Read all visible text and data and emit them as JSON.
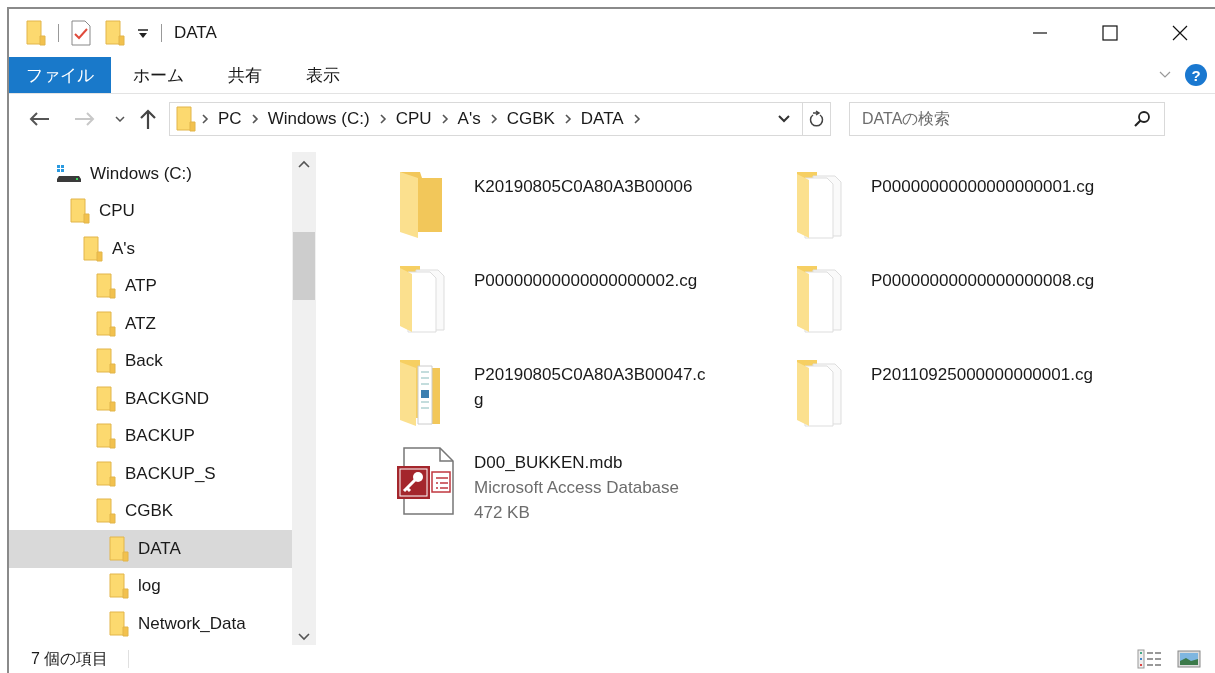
{
  "window": {
    "title": "DATA"
  },
  "ribbon": {
    "tabs": [
      {
        "label": "ファイル",
        "selected": true
      },
      {
        "label": "ホーム",
        "selected": false
      },
      {
        "label": "共有",
        "selected": false
      },
      {
        "label": "表示",
        "selected": false
      }
    ],
    "help_label": "?"
  },
  "navigation": {
    "back_disabled": false,
    "forward_disabled": true
  },
  "address": {
    "path": [
      "PC",
      "Windows (C:)",
      "CPU",
      "A's",
      "CGBK",
      "DATA"
    ]
  },
  "search": {
    "placeholder": "DATAの検索"
  },
  "tree": [
    {
      "label": "Windows (C:)",
      "kind": "drive",
      "selected": false,
      "children": [
        {
          "label": "CPU",
          "kind": "folder",
          "selected": false,
          "children": [
            {
              "label": "A's",
              "kind": "folder",
              "selected": false,
              "children": [
                {
                  "label": "ATP",
                  "kind": "folder",
                  "selected": false
                },
                {
                  "label": "ATZ",
                  "kind": "folder",
                  "selected": false
                },
                {
                  "label": "Back",
                  "kind": "folder",
                  "selected": false
                },
                {
                  "label": "BACKGND",
                  "kind": "folder",
                  "selected": false
                },
                {
                  "label": "BACKUP",
                  "kind": "folder",
                  "selected": false
                },
                {
                  "label": "BACKUP_S",
                  "kind": "folder",
                  "selected": false
                },
                {
                  "label": "CGBK",
                  "kind": "folder",
                  "selected": false,
                  "children": [
                    {
                      "label": "DATA",
                      "kind": "folder",
                      "selected": true
                    },
                    {
                      "label": "log",
                      "kind": "folder",
                      "selected": false
                    },
                    {
                      "label": "Network_Data",
                      "kind": "folder",
                      "selected": false
                    }
                  ]
                }
              ]
            }
          ]
        }
      ]
    }
  ],
  "files": [
    {
      "kind": "folder",
      "name": "K20190805C0A80A3B00006"
    },
    {
      "kind": "document-folder",
      "name": "P00000000000000000001.cg"
    },
    {
      "kind": "document-folder",
      "name": "P00000000000000000002.cg"
    },
    {
      "kind": "document-folder",
      "name": "P00000000000000000008.cg"
    },
    {
      "kind": "picture-folder",
      "name": "P20190805C0A80A3B00047.cg"
    },
    {
      "kind": "document-folder",
      "name": "P20110925000000000001.cg"
    },
    {
      "kind": "access-database",
      "name": "D00_BUKKEN.mdb",
      "type": "Microsoft Access Database",
      "size": "472 KB"
    }
  ],
  "status_bar": {
    "item_count": "7 個の項目"
  }
}
